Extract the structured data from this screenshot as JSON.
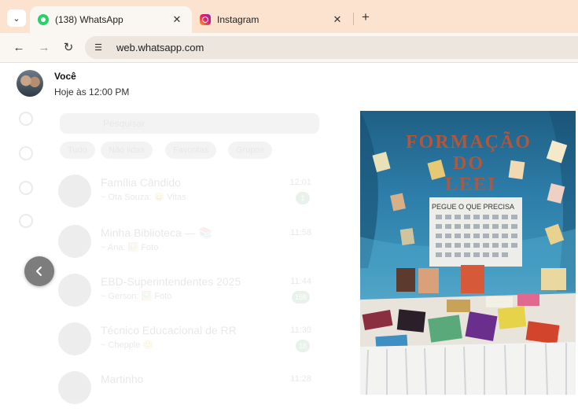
{
  "browser": {
    "tabs": [
      {
        "title": "(138) WhatsApp",
        "icon": "whatsapp-icon",
        "active": true
      },
      {
        "title": "Instagram",
        "icon": "instagram-icon",
        "active": false
      }
    ],
    "url": "web.whatsapp.com"
  },
  "viewer": {
    "sender": "Você",
    "time": "Hoje às 12:00 PM"
  },
  "background_ui": {
    "search_placeholder": "Pesquisar",
    "filters": [
      "Tudo",
      "Não lidas",
      "Favoritas",
      "Grupos"
    ],
    "chats": [
      {
        "name": "Família Cândido",
        "last": "~ Ota Souza: 😄 Vitas",
        "time": "12:01",
        "badge": "1"
      },
      {
        "name": "Minha Biblioteca — 📚",
        "last": "~ Ana: 🖼️ Foto",
        "time": "11:58",
        "badge": ""
      },
      {
        "name": "EBD-Superintendentes 2025",
        "last": "~ Gerson: 🖼️ Foto",
        "time": "11:44",
        "badge": "156"
      },
      {
        "name": "Técnico Educacional de RR",
        "last": "~ Chepple 🙂",
        "time": "11:30",
        "badge": "18"
      },
      {
        "name": "Martinho",
        "last": "",
        "time": "11:28",
        "badge": ""
      }
    ]
  },
  "photo": {
    "banner_title_line1": "FORMAÇÃO",
    "banner_title_line2": "DO",
    "banner_title_line3": "LEEI",
    "sign_text": "PEGUE O QUE PRECISA"
  },
  "colors": {
    "tabstrip": "#fbe3cf",
    "toolbar": "#faf7f3",
    "whatsapp_green": "#25d366",
    "photo_backdrop": "#2d7eaa"
  }
}
